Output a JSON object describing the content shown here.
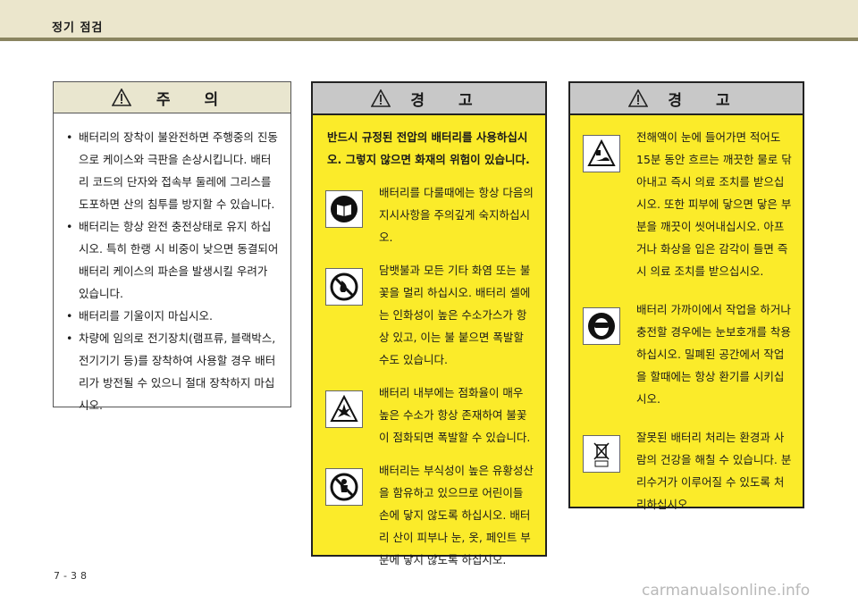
{
  "header": {
    "title": "정기 점검"
  },
  "caution": {
    "title": "주 의",
    "items": [
      "배터리의 장착이 불완전하면 주행중의 진동으로 케이스와 극판을 손상시킵니다. 배터리 코드의 단자와 접속부 둘레에 그리스를 도포하면 산의 침투를 방지할 수 있습니다.",
      "배터리는 항상 완전 충전상태로 유지 하십시오. 특히 한랭 시 비중이 낮으면 동결되어 배터리 케이스의 파손을 발생시킬 우려가 있습니다.",
      "배터리를 기울이지 마십시오.",
      "차량에 임의로 전기장치(램프류, 블랙박스, 전기기기 등)를 장착하여 사용할 경우 배터리가 방전될 수 있으니 절대 장착하지 마십시오."
    ]
  },
  "warning1": {
    "title": "경 고",
    "intro": "반드시 규정된 전압의 배터리를 사용하십시오. 그렇지 않으면 화재의 위험이 있습니다.",
    "items": [
      {
        "icon": "manual-book-icon",
        "text": "배터리를 다룰때에는 항상 다음의 지시사항을 주의깊게 숙지하십시오."
      },
      {
        "icon": "no-fire-icon",
        "text": "담뱃불과 모든 기타 화염 또는 불꽃을 멀리 하십시오. 배터리 셀에는 인화성이 높은 수소가스가 항상 있고, 이는 불 붙으면 폭발할 수도 있습니다."
      },
      {
        "icon": "explosion-icon",
        "text": "배터리 내부에는 점화율이 매우 높은 수소가 항상 존재하여 불꽃이 점화되면 폭발할 수 있습니다."
      },
      {
        "icon": "keep-away-children-icon",
        "text": "배터리는 부식성이 높은 유황성산을 함유하고 있으므로 어린이들 손에 닿지 않도록 하십시오. 배터리 산이 피부나 눈, 옷, 페인트 부분에 닿지 않도록 하십시오."
      }
    ]
  },
  "warning2": {
    "title": "경 고",
    "items": [
      {
        "icon": "acid-burn-icon",
        "text": "전해액이 눈에 들어가면 적어도 15분 동안 흐르는 깨끗한 물로 닦아내고 즉시 의료 조치를 받으십시오. 또한 피부에 닿으면 닿은 부분을 깨끗이 씻어내십시오. 아프거나 화상을 입은 감각이 들면 즉시 의료 조치를 받으십시오."
      },
      {
        "icon": "eye-protection-icon",
        "text": "배터리 가까이에서 작업을 하거나 충전할 경우에는 눈보호개를 착용하십시오. 밀폐된 공간에서 작업을 할때에는 항상 환기를 시키십시오."
      },
      {
        "icon": "recycle-pb-icon",
        "text": "잘못된 배터리 처리는 환경과 사람의 건강을 해칠 수 있습니다. 분리수거가 이루어질 수 있도록 처리하십시오."
      }
    ]
  },
  "page_number": "7-38",
  "watermark": "carmanualsonline.info"
}
